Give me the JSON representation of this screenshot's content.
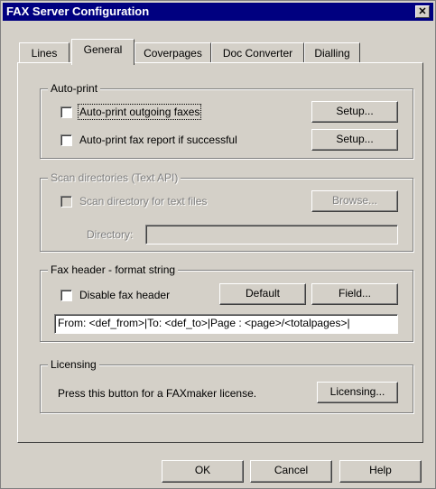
{
  "window": {
    "title": "FAX Server Configuration",
    "close_glyph": "✕"
  },
  "tabs": [
    {
      "label": "Lines",
      "active": false
    },
    {
      "label": "General",
      "active": true
    },
    {
      "label": "Coverpages",
      "active": false
    },
    {
      "label": "Doc Converter",
      "active": false
    },
    {
      "label": "Dialling",
      "active": false
    }
  ],
  "auto_print": {
    "legend": "Auto-print",
    "outgoing": {
      "label": "Auto-print outgoing faxes",
      "checked": false,
      "setup_label": "Setup..."
    },
    "report": {
      "label": "Auto-print fax report if successful",
      "checked": false,
      "setup_label": "Setup..."
    }
  },
  "scan": {
    "legend": "Scan directories (Text API)",
    "checkbox_label": "Scan directory for text files",
    "checked": false,
    "browse_label": "Browse...",
    "directory_label": "Directory:",
    "directory_value": ""
  },
  "fax_header": {
    "legend": "Fax header - format string",
    "disable_label": "Disable fax header",
    "disabled_checked": false,
    "default_label": "Default",
    "field_label": "Field...",
    "format_value": "From: <def_from>|To: <def_to>|Page : <page>/<totalpages>|"
  },
  "licensing": {
    "legend": "Licensing",
    "text": "Press this button for a FAXmaker license.",
    "button_label": "Licensing..."
  },
  "footer": {
    "ok_label": "OK",
    "cancel_label": "Cancel",
    "help_label": "Help"
  },
  "colors": {
    "face": "#d4d0c8",
    "title_bar": "#000080",
    "disabled_text": "#808080"
  }
}
